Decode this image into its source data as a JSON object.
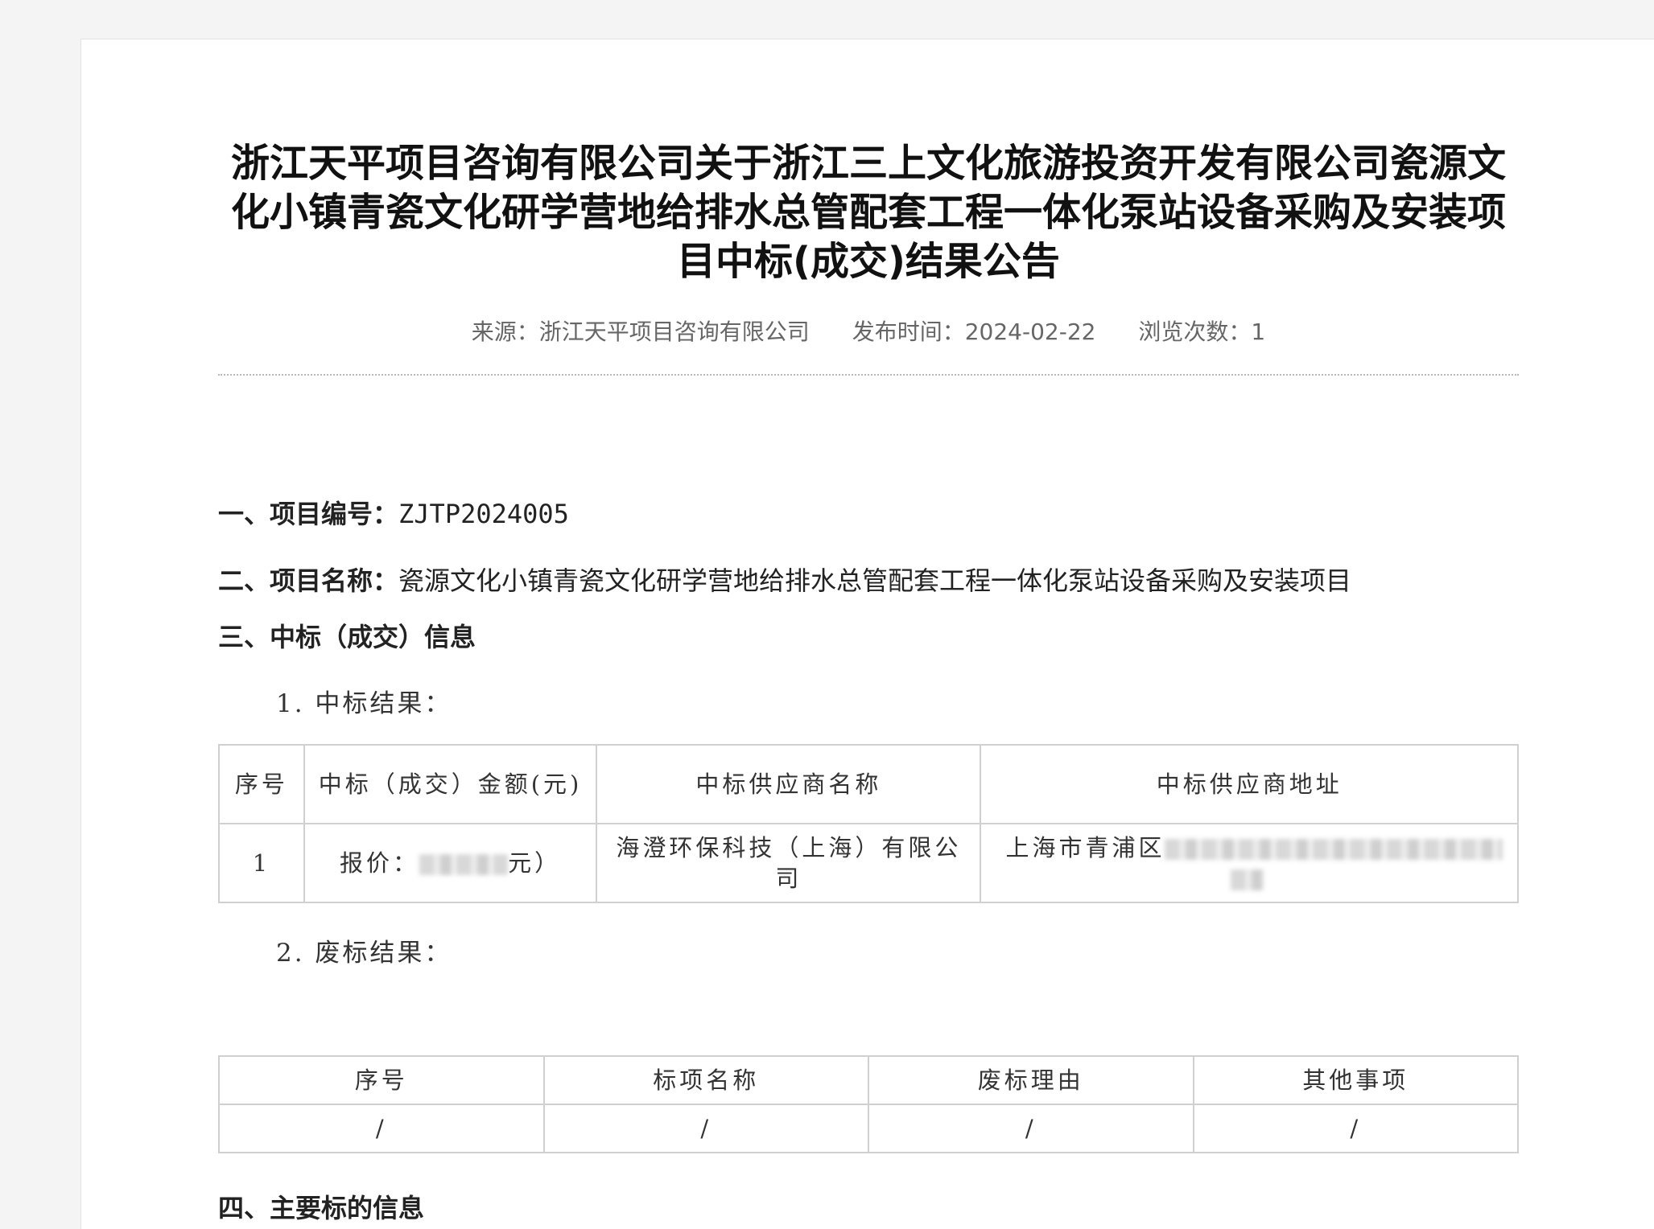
{
  "article": {
    "title": "浙江天平项目咨询有限公司关于浙江三上文化旅游投资开发有限公司瓷源文化小镇青瓷文化研学营地给排水总管配套工程一体化泵站设备采购及安装项目中标(成交)结果公告",
    "meta": {
      "source": "来源：浙江天平项目咨询有限公司",
      "publish_time": "发布时间：2024-02-22",
      "views": "浏览次数：1"
    }
  },
  "sections": {
    "project_no_label": "一、项目编号：",
    "project_no_value": "ZJTP2024005",
    "project_name_label": "二、项目名称：",
    "project_name_value": "瓷源文化小镇青瓷文化研学营地给排水总管配套工程一体化泵站设备采购及安装项目",
    "award_info": "三、中标（成交）信息",
    "award_result": "1. 中标结果：",
    "invalid_result": "2. 废标结果：",
    "main_items": "四、主要标的信息"
  },
  "award_table": {
    "headers": [
      "序号",
      "中标（成交）金额(元)",
      "中标供应商名称",
      "中标供应商地址"
    ],
    "rows": [
      {
        "index": "1",
        "price_prefix": "报价：",
        "price_suffix": "元）",
        "supplier": "海澄环保科技（上海）有限公司",
        "address_prefix": "上海市青浦区"
      }
    ]
  },
  "invalid_table": {
    "headers": [
      "序号",
      "标项名称",
      "废标理由",
      "其他事项"
    ],
    "rows": [
      [
        "/",
        "/",
        "/",
        "/"
      ]
    ]
  }
}
